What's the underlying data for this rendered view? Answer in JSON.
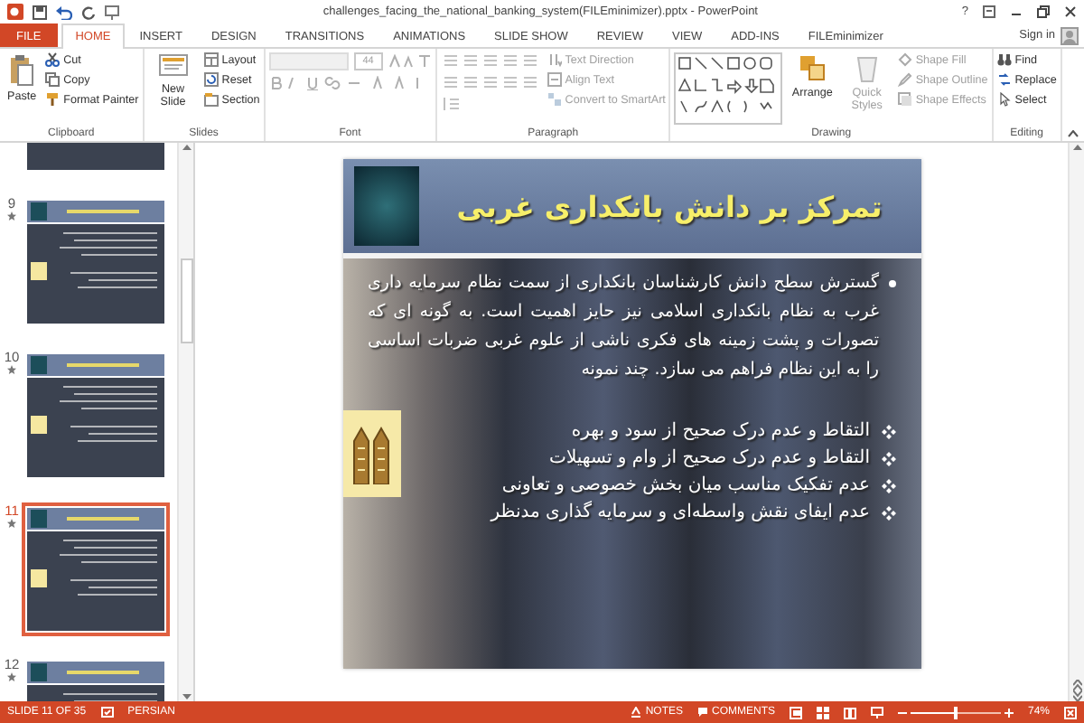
{
  "window": {
    "title": "challenges_facing_the_national_banking_system(FILEminimizer).pptx - PowerPoint",
    "help": "?",
    "sign_in": "Sign in"
  },
  "tabs": [
    {
      "label": "FILE",
      "kind": "file",
      "selected": false
    },
    {
      "label": "HOME",
      "kind": "tab",
      "selected": true
    },
    {
      "label": "INSERT",
      "kind": "tab",
      "selected": false
    },
    {
      "label": "DESIGN",
      "kind": "tab",
      "selected": false
    },
    {
      "label": "TRANSITIONS",
      "kind": "tab",
      "selected": false
    },
    {
      "label": "ANIMATIONS",
      "kind": "tab",
      "selected": false
    },
    {
      "label": "SLIDE SHOW",
      "kind": "tab",
      "selected": false
    },
    {
      "label": "REVIEW",
      "kind": "tab",
      "selected": false
    },
    {
      "label": "VIEW",
      "kind": "tab",
      "selected": false
    },
    {
      "label": "ADD-INS",
      "kind": "tab",
      "selected": false
    },
    {
      "label": "FILEminimizer",
      "kind": "tab",
      "selected": false
    }
  ],
  "ribbon": [
    {
      "label": "Clipboard",
      "items": [
        {
          "kind": "large",
          "label": "Paste",
          "disabled": false
        },
        {
          "kind": "small",
          "label": "Cut",
          "disabled": false
        },
        {
          "kind": "small",
          "label": "Copy",
          "disabled": false
        },
        {
          "kind": "small",
          "label": "Format Painter",
          "disabled": false
        }
      ]
    },
    {
      "label": "Slides",
      "items": [
        {
          "kind": "large",
          "label": "New Slide",
          "disabled": false
        },
        {
          "kind": "small",
          "label": "Layout",
          "disabled": false
        },
        {
          "kind": "small",
          "label": "Reset",
          "disabled": false
        },
        {
          "kind": "small",
          "label": "Section",
          "disabled": false
        }
      ]
    },
    {
      "label": "Font",
      "items": [
        {
          "kind": "font",
          "value": "44",
          "disabled": true
        }
      ]
    },
    {
      "label": "Paragraph",
      "items": [
        {
          "kind": "para",
          "disabled": true
        },
        {
          "kind": "small",
          "label": "Text Direction",
          "disabled": true
        },
        {
          "kind": "small",
          "label": "Align Text",
          "disabled": true
        },
        {
          "kind": "small",
          "label": "Convert to SmartArt",
          "disabled": true
        }
      ]
    },
    {
      "label": "Drawing",
      "items": [
        {
          "kind": "gallery",
          "disabled": false
        },
        {
          "kind": "large",
          "label": "Arrange",
          "disabled": false
        },
        {
          "kind": "large",
          "label": "Quick Styles",
          "disabled": true
        },
        {
          "kind": "small",
          "label": "Shape Fill",
          "disabled": true
        },
        {
          "kind": "small",
          "label": "Shape Outline",
          "disabled": true
        },
        {
          "kind": "small",
          "label": "Shape Effects",
          "disabled": true
        }
      ]
    },
    {
      "label": "Editing",
      "items": [
        {
          "kind": "small",
          "label": "Find",
          "disabled": false
        },
        {
          "kind": "small",
          "label": "Replace",
          "disabled": false
        },
        {
          "kind": "small",
          "label": "Select",
          "disabled": false
        }
      ]
    }
  ],
  "thumbnails": [
    {
      "number": "9",
      "selected": false
    },
    {
      "number": "10",
      "selected": false
    },
    {
      "number": "11",
      "selected": true
    },
    {
      "number": "12",
      "selected": false
    }
  ],
  "slide": {
    "title": "تمرکز بر دانش بانکداری غربی",
    "paragraph": "گسترش سطح دانش کارشناسان بانکداری از سمت نظام سرمایه داری غرب به نظام بانکداری اسلامی نیز حایز اهمیت است. به گونه ای که تصورات و پشت زمینه های فکری ناشی از علوم غربی ضربات اساسی را به این نظام فراهم می سازد. چند نمونه",
    "bullets": [
      "التقاط و عدم درک صحیح از سود و بهره",
      "التقاط و عدم درک صحیح از وام و تسهیلات",
      "عدم تفکیک مناسب میان بخش خصوصی و تعاونی",
      "عدم ایفای نقش واسطه‌ای و سرمایه گذاری مدنظر"
    ]
  },
  "status_bar": {
    "slide": "SLIDE 11 OF 35",
    "language": "PERSIAN",
    "notes": "NOTES",
    "comments": "COMMENTS",
    "zoom": "74%",
    "zoom_level": {
      "level": 0.5
    }
  }
}
